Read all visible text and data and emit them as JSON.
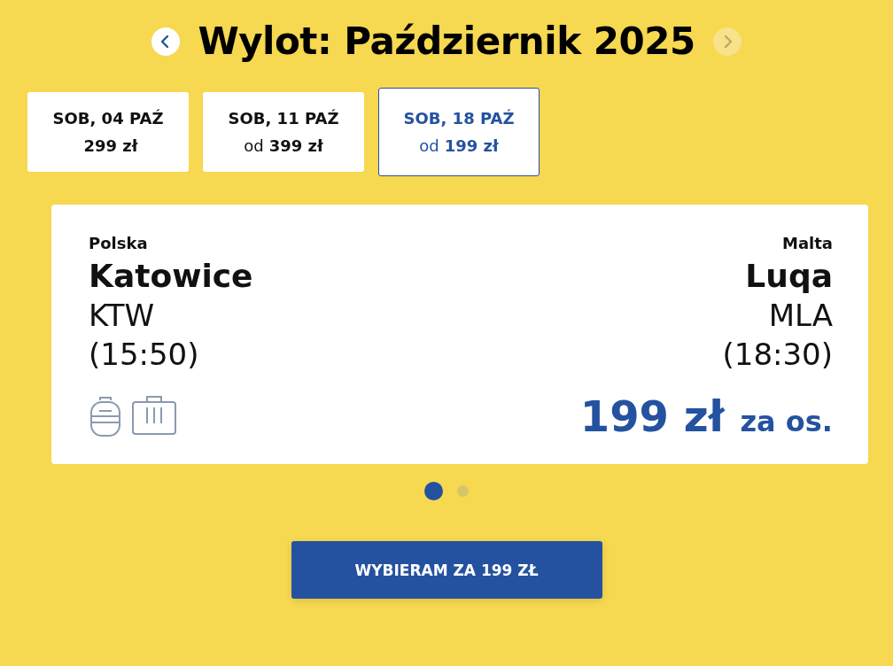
{
  "header": {
    "title": "Wylot: Październik 2025",
    "prev": {
      "disabled": false
    },
    "next": {
      "disabled": true
    }
  },
  "date_tabs": [
    {
      "date": "SOB, 04 PAŹ",
      "price": "299 zł",
      "selected": false
    },
    {
      "date": "SOB, 11 PAŹ",
      "prefix": "od",
      "price": "399 zł",
      "selected": false
    },
    {
      "date": "SOB, 18 PAŹ",
      "prefix": "od",
      "price": "199 zł",
      "selected": true
    }
  ],
  "flight": {
    "origin": {
      "country": "Polska",
      "city": "Katowice",
      "code": "KTW",
      "time": "(15:50)"
    },
    "destination": {
      "country": "Malta",
      "city": "Luqa",
      "code": "MLA",
      "time": "(18:30)"
    },
    "baggage": [
      {
        "kind": "backpack"
      },
      {
        "kind": "suitcase"
      }
    ],
    "price": "199 zł",
    "price_unit": "za os."
  },
  "pager": [
    {
      "selected": true
    },
    {
      "selected": false
    }
  ],
  "cta": {
    "label": "WYBIERAM ZA 199 ZŁ"
  }
}
